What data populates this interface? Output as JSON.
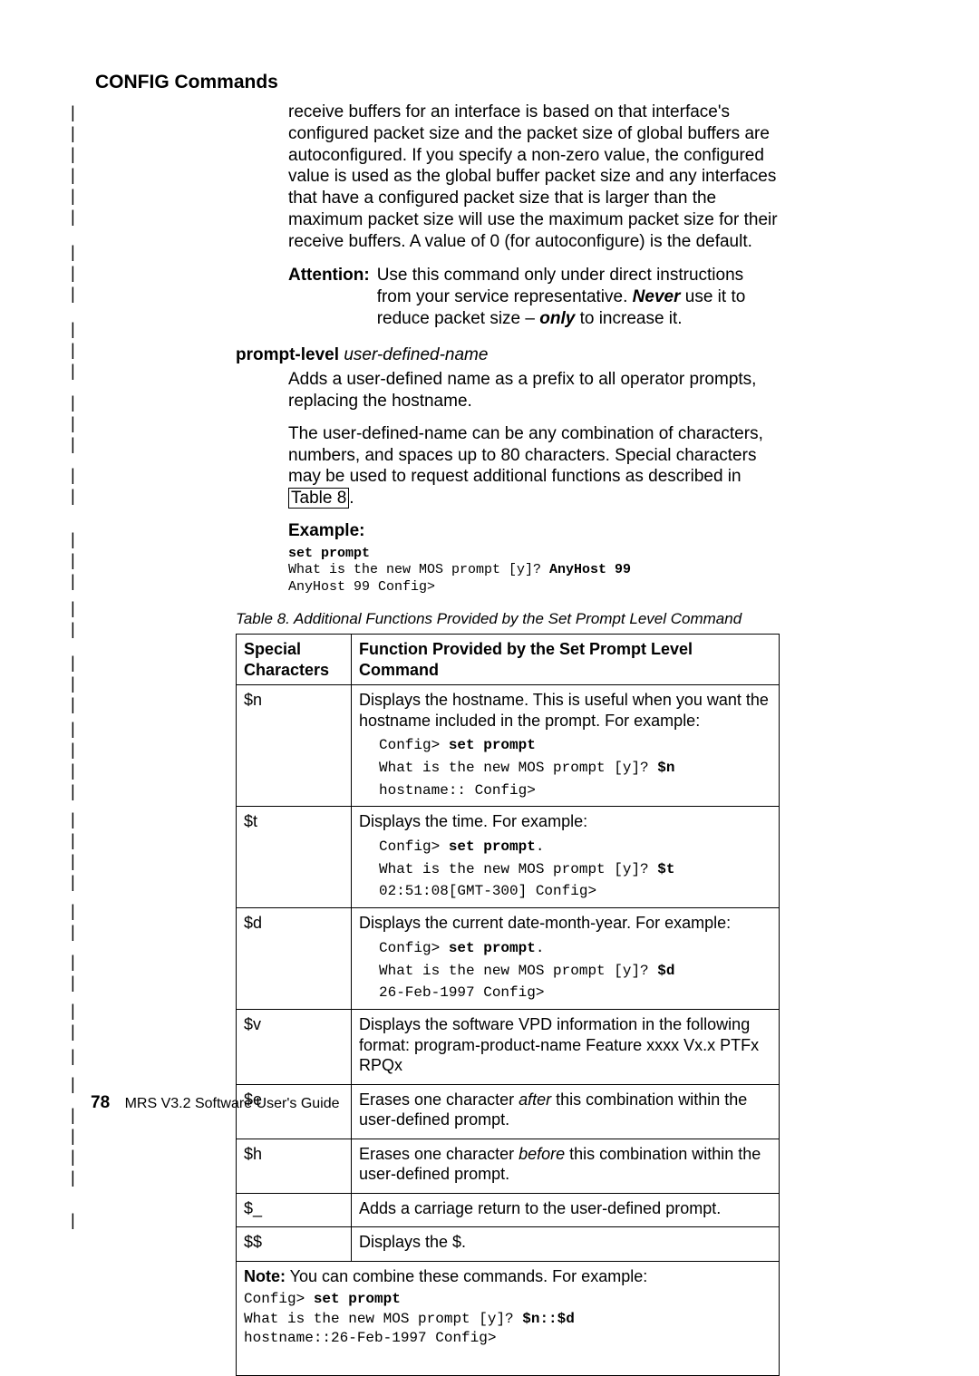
{
  "header": {
    "section_title": "CONFIG Commands"
  },
  "intro_para": "receive buffers for an interface is based on that interface's configured packet size and the packet size of global buffers are autoconfigured. If you specify a non-zero value, the configured value is used as the global buffer packet size and any interfaces that have a configured packet size that is larger than the maximum packet size will use the maximum packet size for their receive buffers. A value of 0 (for autoconfigure) is the default.",
  "attention": {
    "label": "Attention:",
    "body_pre": "Use this command only under direct instructions from your service representative. ",
    "never": "Never",
    "body_mid": " use it to reduce packet size – ",
    "only": "only",
    "body_post": " to increase it."
  },
  "term": {
    "keyword": "prompt-level",
    "arg": "user-defined-name",
    "p1": "Adds a user-defined name as a prefix to all operator prompts, replacing the hostname.",
    "p2_pre": "The user-defined-name can be any combination of characters, numbers, and spaces up to 80 characters. Special characters may be used to request additional functions as described in ",
    "p2_link": "Table 8",
    "p2_post": "."
  },
  "example": {
    "label": "Example:",
    "l1_bold": "set prompt",
    "l2_pre": "What is the new MOS prompt [y]? ",
    "l2_bold": "AnyHost 99",
    "l3": "AnyHost 99 Config>"
  },
  "table": {
    "caption": "Table 8. Additional Functions Provided by the Set Prompt Level Command",
    "h1a": "Special",
    "h1b": "Characters",
    "h2": "Function Provided by the Set Prompt Level Command",
    "rows": [
      {
        "char": "$n",
        "desc": "Displays the hostname. This is useful when you want the hostname included in the prompt. For example:",
        "code": [
          {
            "pre": "Config> ",
            "bold": "set prompt"
          },
          {
            "pre": "What is the new MOS prompt [y]? ",
            "bold": "$n"
          },
          {
            "pre": "hostname:: Config>"
          }
        ]
      },
      {
        "char": "$t",
        "desc": "Displays the time. For example:",
        "code": [
          {
            "pre": "Config> ",
            "bold": "set prompt",
            "post": "."
          },
          {
            "pre": "What is the new MOS prompt [y]? ",
            "bold": "$t"
          },
          {
            "pre": "02:51:08[GMT-300] Config>"
          }
        ]
      },
      {
        "char": "$d",
        "desc": "Displays the current date-month-year. For example:",
        "code": [
          {
            "pre": "Config> ",
            "bold": "set prompt",
            "post": "."
          },
          {
            "pre": "What is the new MOS prompt [y]? ",
            "bold": "$d"
          },
          {
            "pre": "26-Feb-1997 Config>"
          }
        ]
      },
      {
        "char": "$v",
        "desc": "Displays the software VPD information in the following format: program-product-name Feature xxxx Vx.x PTFx RPQx"
      },
      {
        "char": "$e",
        "desc_pre": "Erases one character ",
        "desc_ital": "after",
        "desc_post": " this combination within the user-defined prompt."
      },
      {
        "char": "$h",
        "desc_pre": "Erases one character ",
        "desc_ital": "before",
        "desc_post": " this combination within the user-defined prompt."
      },
      {
        "char": "$_",
        "desc": "Adds a carriage return to the user-defined prompt."
      },
      {
        "char": "$$",
        "desc": "Displays the $."
      }
    ],
    "note": {
      "label": "Note:",
      "text": " You can combine these commands. For example:",
      "code": [
        {
          "pre": "Config> ",
          "bold": "set prompt"
        },
        {
          "pre": "What is the new MOS prompt [y]? ",
          "bold": "$n::$d"
        },
        {
          "pre": "hostname::26-Feb-1997 Config>"
        }
      ]
    }
  },
  "footer": {
    "page": "78",
    "doc": "MRS V3.2 Software User's Guide"
  }
}
